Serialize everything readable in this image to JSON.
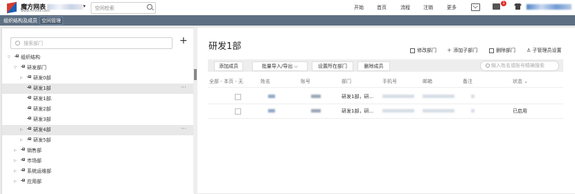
{
  "topbar": {
    "logo_name": "魔方网表",
    "logo_url": "www.mf999.com",
    "search_placeholder": "空间检索",
    "nav": [
      "开始",
      "首页",
      "流程",
      "注销",
      "更多"
    ],
    "badge_count": "1"
  },
  "subbar": {
    "tabs": [
      "组织结构及成员",
      "空间管理"
    ]
  },
  "left_panel": {
    "search_placeholder": "搜索部门",
    "tree": [
      {
        "label": "组织结构",
        "level": 0,
        "toggle": "▽"
      },
      {
        "label": "研发部门",
        "level": 1,
        "toggle": "▽"
      },
      {
        "label": "研发0部",
        "level": 2,
        "toggle": "▷"
      },
      {
        "label": "研发1部",
        "level": 2,
        "toggle": "",
        "selected": true
      },
      {
        "label": "研发1部.",
        "level": 2,
        "toggle": ""
      },
      {
        "label": "研发2部",
        "level": 2,
        "toggle": ""
      },
      {
        "label": "研发3部",
        "level": 2,
        "toggle": ""
      },
      {
        "label": "研发4部",
        "level": 2,
        "toggle": "▷",
        "selected": true
      },
      {
        "label": "研发5部",
        "level": 2,
        "toggle": "▷"
      },
      {
        "label": "销售部",
        "level": 1,
        "toggle": "▷"
      },
      {
        "label": "市场部",
        "level": 1,
        "toggle": "▷"
      },
      {
        "label": "系统运维部",
        "level": 1,
        "toggle": "▷"
      },
      {
        "label": "应用部",
        "level": 1,
        "toggle": "▷"
      }
    ]
  },
  "main": {
    "title": "研发1部",
    "actions": [
      "修改部门",
      "添加子部门",
      "删除部门",
      "子管理员设置"
    ],
    "toolbar_buttons": [
      "添加成员",
      "批量导入/导出",
      "设置所在部门",
      "删除成员"
    ],
    "toolbar_search_placeholder": "输入姓名或账号精确搜索",
    "columns": [
      "全部 - 本页 - 无",
      "姓名",
      "账号",
      "部门",
      "手机号",
      "邮箱",
      "备注",
      "状态"
    ],
    "rows": [
      {
        "department": "研发1部，研...",
        "status": ""
      },
      {
        "department": "研发1部，研...",
        "status": "已启用"
      }
    ]
  },
  "colors": {
    "subbar": "#5d6f82",
    "badge": "#e02b2b",
    "selected_row": "#e8e8e8"
  }
}
